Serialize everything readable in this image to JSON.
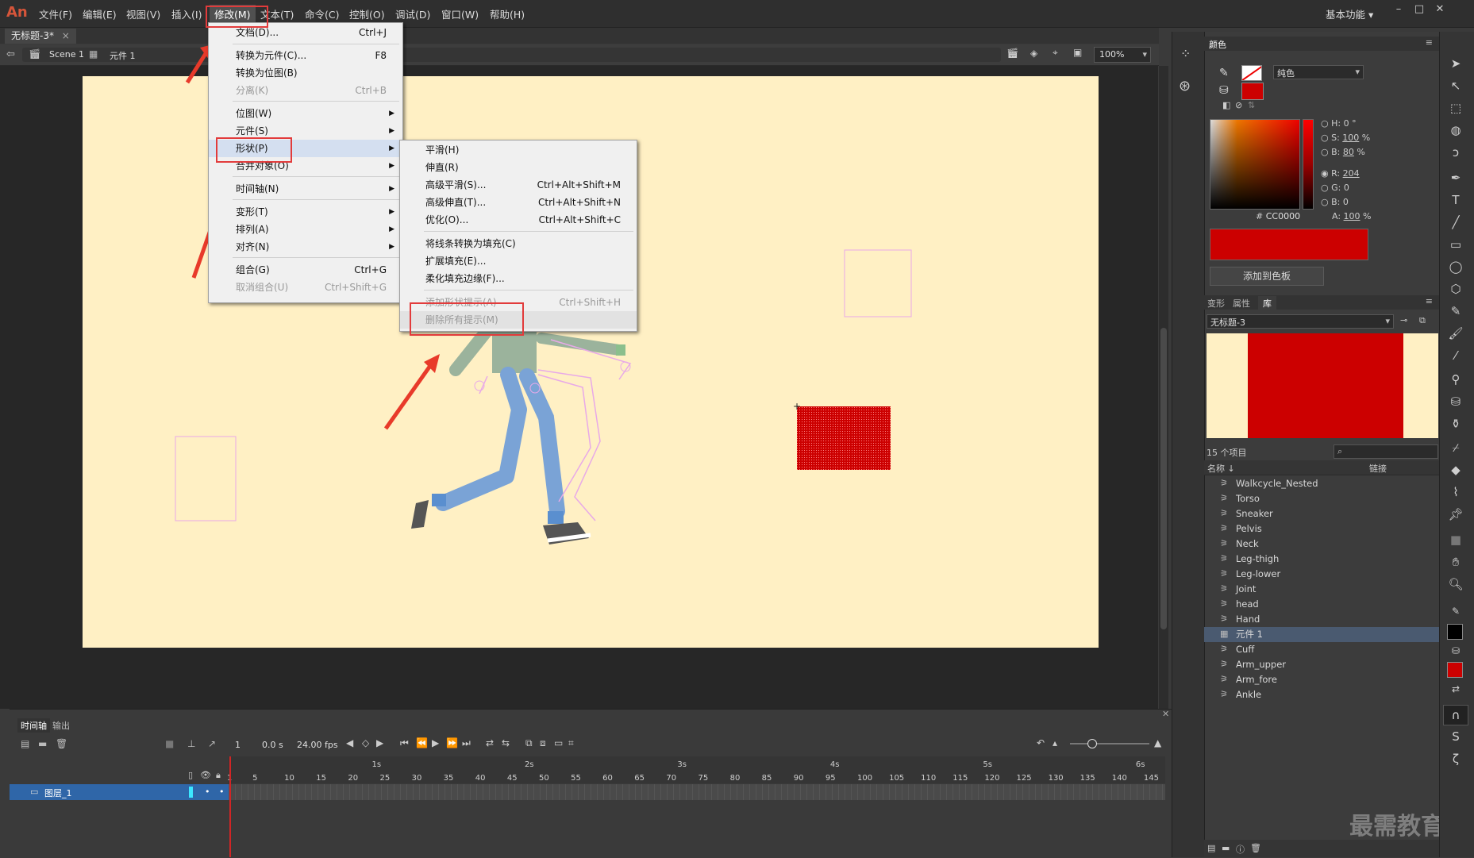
{
  "menubar": {
    "logo": "An",
    "items": [
      "文件(F)",
      "编辑(E)",
      "视图(V)",
      "插入(I)",
      "修改(M)",
      "文本(T)",
      "命令(C)",
      "控制(O)",
      "调试(D)",
      "窗口(W)",
      "帮助(H)"
    ],
    "workspace": "基本功能"
  },
  "document": {
    "tab": "无标题-3*",
    "scene": "Scene 1",
    "symbol": "元件 1",
    "zoom": "100%"
  },
  "modify_menu": {
    "items": [
      {
        "label": "文档(D)...",
        "shortcut": "Ctrl+J"
      },
      {
        "label": "转换为元件(C)...",
        "shortcut": "F8"
      },
      {
        "label": "转换为位图(B)",
        "shortcut": ""
      },
      {
        "label": "分离(K)",
        "shortcut": "Ctrl+B"
      },
      {
        "label": "位图(W)",
        "shortcut": ""
      },
      {
        "label": "元件(S)",
        "shortcut": ""
      },
      {
        "label": "形状(P)",
        "shortcut": ""
      },
      {
        "label": "合并对象(O)",
        "shortcut": ""
      },
      {
        "label": "时间轴(N)",
        "shortcut": ""
      },
      {
        "label": "变形(T)",
        "shortcut": ""
      },
      {
        "label": "排列(A)",
        "shortcut": ""
      },
      {
        "label": "对齐(N)",
        "shortcut": ""
      },
      {
        "label": "组合(G)",
        "shortcut": "Ctrl+G"
      },
      {
        "label": "取消组合(U)",
        "shortcut": "Ctrl+Shift+G"
      }
    ]
  },
  "shape_submenu": {
    "items": [
      {
        "label": "平滑(H)",
        "shortcut": ""
      },
      {
        "label": "伸直(R)",
        "shortcut": ""
      },
      {
        "label": "高级平滑(S)...",
        "shortcut": "Ctrl+Alt+Shift+M"
      },
      {
        "label": "高级伸直(T)...",
        "shortcut": "Ctrl+Alt+Shift+N"
      },
      {
        "label": "优化(O)...",
        "shortcut": "Ctrl+Alt+Shift+C"
      },
      {
        "label": "将线条转换为填充(C)",
        "shortcut": ""
      },
      {
        "label": "扩展填充(E)...",
        "shortcut": ""
      },
      {
        "label": "柔化填充边缘(F)...",
        "shortcut": ""
      },
      {
        "label": "添加形状提示(A)",
        "shortcut": "Ctrl+Shift+H"
      },
      {
        "label": "删除所有提示(M)",
        "shortcut": ""
      }
    ]
  },
  "color_panel": {
    "title": "颜色",
    "fill_type": "纯色",
    "h": "0",
    "h_unit": "°",
    "s": "100",
    "s_unit": "%",
    "b": "80",
    "b_unit": "%",
    "r": "204",
    "g": "0",
    "bl": "0",
    "hex_prefix": "#",
    "hex": "CC0000",
    "alpha": "100",
    "alpha_unit": "%",
    "add_swatch": "添加到色板",
    "fill_color": "#cc0000"
  },
  "library_panel": {
    "tabs": [
      "变形",
      "属性",
      "库"
    ],
    "document": "无标题-3",
    "count": "15 个项目",
    "col_name": "名称",
    "col_link": "链接",
    "items": [
      "Walkcycle_Nested",
      "Torso",
      "Sneaker",
      "Pelvis",
      "Neck",
      "Leg-thigh",
      "Leg-lower",
      "Joint",
      "head",
      "Hand",
      "元件 1",
      "Cuff",
      "Arm_upper",
      "Arm_fore",
      "Ankle"
    ]
  },
  "timeline": {
    "tabs": [
      "时间轴",
      "输出"
    ],
    "frame": "1",
    "time": "0.0 s",
    "fps": "24.00 fps",
    "layer": "图层_1",
    "seconds": [
      "1s",
      "2s",
      "3s",
      "4s",
      "5s",
      "6s"
    ],
    "frames": [
      "1",
      "5",
      "10",
      "15",
      "20",
      "25",
      "30",
      "35",
      "40",
      "45",
      "50",
      "55",
      "60",
      "65",
      "70",
      "75",
      "80",
      "85",
      "90",
      "95",
      "100",
      "105",
      "110",
      "115",
      "120",
      "125",
      "130",
      "135",
      "140",
      "145"
    ]
  },
  "watermark": "最需教育"
}
